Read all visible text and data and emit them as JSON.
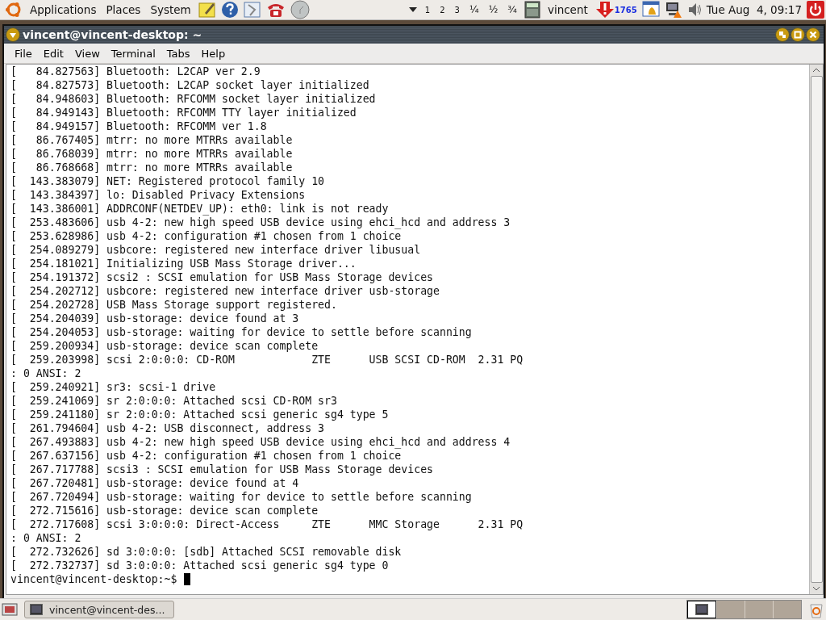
{
  "top_panel": {
    "menus": [
      "Applications",
      "Places",
      "System"
    ],
    "workspace_labels": [
      "1",
      "2",
      "3",
      "¼",
      "½",
      "¾"
    ],
    "user": "vincent",
    "update_count": "1765",
    "clock": "Tue Aug  4, 09:17"
  },
  "window": {
    "title": "vincent@vincent-desktop: ~"
  },
  "menubar": [
    "File",
    "Edit",
    "View",
    "Terminal",
    "Tabs",
    "Help"
  ],
  "terminal": {
    "lines": [
      "[   84.827563] Bluetooth: L2CAP ver 2.9",
      "[   84.827573] Bluetooth: L2CAP socket layer initialized",
      "[   84.948603] Bluetooth: RFCOMM socket layer initialized",
      "[   84.949143] Bluetooth: RFCOMM TTY layer initialized",
      "[   84.949157] Bluetooth: RFCOMM ver 1.8",
      "[   86.767405] mtrr: no more MTRRs available",
      "[   86.768039] mtrr: no more MTRRs available",
      "[   86.768668] mtrr: no more MTRRs available",
      "[  143.383079] NET: Registered protocol family 10",
      "[  143.384397] lo: Disabled Privacy Extensions",
      "[  143.386001] ADDRCONF(NETDEV_UP): eth0: link is not ready",
      "[  253.483606] usb 4-2: new high speed USB device using ehci_hcd and address 3",
      "[  253.628986] usb 4-2: configuration #1 chosen from 1 choice",
      "[  254.089279] usbcore: registered new interface driver libusual",
      "[  254.181021] Initializing USB Mass Storage driver...",
      "[  254.191372] scsi2 : SCSI emulation for USB Mass Storage devices",
      "[  254.202712] usbcore: registered new interface driver usb-storage",
      "[  254.202728] USB Mass Storage support registered.",
      "[  254.204039] usb-storage: device found at 3",
      "[  254.204053] usb-storage: waiting for device to settle before scanning",
      "[  259.200934] usb-storage: device scan complete",
      "[  259.203998] scsi 2:0:0:0: CD-ROM            ZTE      USB SCSI CD-ROM  2.31 PQ",
      ": 0 ANSI: 2",
      "[  259.240921] sr3: scsi-1 drive",
      "[  259.241069] sr 2:0:0:0: Attached scsi CD-ROM sr3",
      "[  259.241180] sr 2:0:0:0: Attached scsi generic sg4 type 5",
      "[  261.794604] usb 4-2: USB disconnect, address 3",
      "[  267.493883] usb 4-2: new high speed USB device using ehci_hcd and address 4",
      "[  267.637156] usb 4-2: configuration #1 chosen from 1 choice",
      "[  267.717788] scsi3 : SCSI emulation for USB Mass Storage devices",
      "[  267.720481] usb-storage: device found at 4",
      "[  267.720494] usb-storage: waiting for device to settle before scanning",
      "[  272.715616] usb-storage: device scan complete",
      "[  272.717608] scsi 3:0:0:0: Direct-Access     ZTE      MMC Storage      2.31 PQ",
      ": 0 ANSI: 2",
      "[  272.732626] sd 3:0:0:0: [sdb] Attached SCSI removable disk",
      "[  272.732737] sd 3:0:0:0: Attached scsi generic sg4 type 0"
    ],
    "prompt": "vincent@vincent-desktop:~$"
  },
  "taskbar": {
    "tasks": [
      {
        "label": "vincent@vincent-des...",
        "selected": false
      }
    ]
  }
}
